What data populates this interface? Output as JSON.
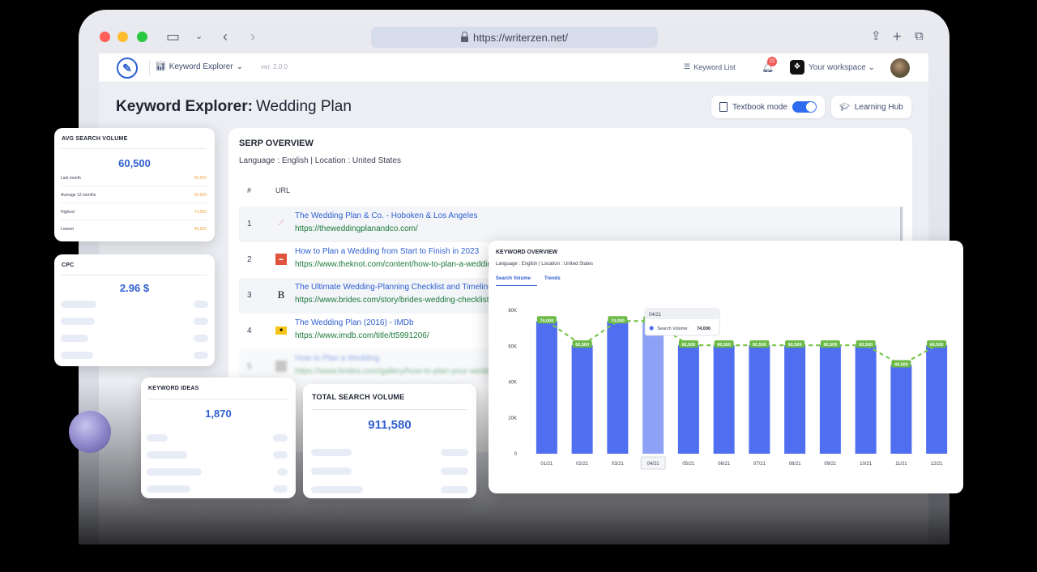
{
  "browser": {
    "url": "https://writerzen.net/"
  },
  "appbar": {
    "logo_letter": "✎",
    "menu_label": "Keyword Explorer",
    "version": "ver. 2.0.0",
    "keyword_list_label": "Keyword List",
    "notification_count": "22",
    "workspace_label": "Your workspace"
  },
  "page": {
    "title_bold": "Keyword Explorer:",
    "title_keyword": "Wedding Plan",
    "textbook_mode_label": "Textbook mode",
    "learning_hub_label": "Learning Hub"
  },
  "serp": {
    "title": "SERP OVERVIEW",
    "language_location": "Language : English | Location : United States",
    "col_num": "#",
    "col_url": "URL",
    "rows": [
      {
        "n": "1",
        "title": "The Wedding Plan & Co. - Hoboken & Los Angeles",
        "url": "https://theweddingplanandco.com/"
      },
      {
        "n": "2",
        "title": "How to Plan a Wedding from Start to Finish in 2023",
        "url": "https://www.theknot.com/content/how-to-plan-a-wedding"
      },
      {
        "n": "3",
        "title": "The Ultimate Wedding-Planning Checklist and Timeline",
        "url": "https://www.brides.com/story/brides-wedding-checklist"
      },
      {
        "n": "4",
        "title": "The Wedding Plan (2016) - IMDb",
        "url": "https://www.imdb.com/title/tt5991206/"
      },
      {
        "n": "5",
        "title": "How to Plan a Wedding",
        "url": "https://www.brides.com/gallery/how-to-plan-your-wedding"
      }
    ]
  },
  "avg_search_volume": {
    "title": "AVG SEARCH VOLUME",
    "value": "60,500",
    "rows": [
      {
        "label": "Last month",
        "value": "60,500"
      },
      {
        "label": "Average 12 months",
        "value": "60,500"
      },
      {
        "label": "Highest",
        "value": "74,000"
      },
      {
        "label": "Lowest",
        "value": "49,500"
      }
    ]
  },
  "cpc": {
    "title": "CPC",
    "value": "2.96 $"
  },
  "keyword_ideas": {
    "title": "KEYWORD IDEAS",
    "value": "1,870"
  },
  "total_search_volume": {
    "title": "TOTAL SEARCH VOLUME",
    "value": "911,580"
  },
  "keyword_overview": {
    "title": "KEYWORD OVERVIEW",
    "language_location": "Language : English | Location : United States",
    "tab_search_volume": "Search Volume",
    "tab_trends": "Trends",
    "tooltip": {
      "month": "04/21",
      "label": "Search Volume:",
      "value": "74,000"
    }
  },
  "chart_data": {
    "type": "bar",
    "categories": [
      "01/21",
      "02/21",
      "03/21",
      "04/21",
      "05/21",
      "06/21",
      "07/21",
      "08/21",
      "09/21",
      "10/21",
      "11/21",
      "12/21"
    ],
    "values": [
      74000,
      60500,
      74000,
      74000,
      60500,
      60500,
      60500,
      60500,
      60500,
      60500,
      49500,
      60500
    ],
    "data_labels": [
      "74,000",
      "60,500",
      "74,000",
      "74,000",
      "60,500",
      "60,500",
      "60,500",
      "60,500",
      "60,500",
      "60,500",
      "49,500",
      "60,500"
    ],
    "highlighted_index": 3,
    "yticks": [
      "0",
      "20K",
      "40K",
      "60K",
      "80K"
    ],
    "ylim": [
      0,
      80000
    ],
    "trend_line": "dashed",
    "colors": {
      "bar": "#4f6ef0",
      "bar_highlight": "#8ea2f5",
      "trend": "#7cc64e",
      "label_bg": "#69b944"
    }
  }
}
